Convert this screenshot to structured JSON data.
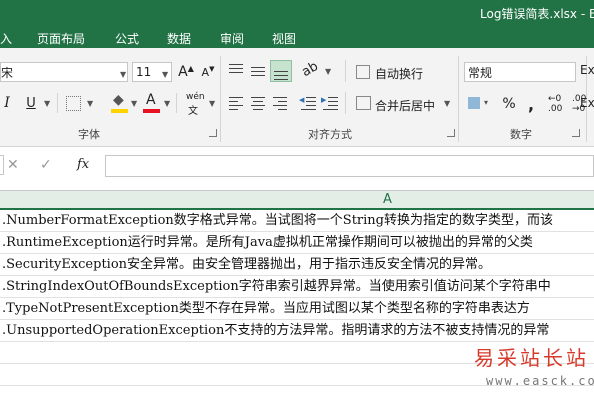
{
  "window": {
    "title": "Log错误简表.xlsx - Exc"
  },
  "tabs": [
    "入",
    "页面布局",
    "公式",
    "数据",
    "审阅",
    "视图"
  ],
  "font_group": {
    "font_name": "宋",
    "font_size": "11",
    "grow_label": "A",
    "shrink_label": "A",
    "italic": "I",
    "underline": "U",
    "fill_letter": "◆",
    "font_color_letter": "A",
    "phonetic": "wén",
    "label": "字体",
    "fill_color": "#ffd400",
    "font_color": "#e81123"
  },
  "align_group": {
    "wrap_text": "自动换行",
    "merge_center": "合并后居中",
    "label": "对齐方式"
  },
  "number_group": {
    "format": "常规",
    "currency": "▾",
    "percent": "%",
    "comma": ",",
    "label": "数字",
    "next_group_partial": "Exc",
    "next_group_partial2": "Exc"
  },
  "formula_bar": {
    "cancel": "✕",
    "enter": "✓",
    "fx": "fx",
    "content": ""
  },
  "grid": {
    "column_header": "A",
    "rows": [
      ".NumberFormatException数字格式异常。当试图将一个String转换为指定的数字类型，而该",
      ".RuntimeException运行时异常。是所有Java虚拟机正常操作期间可以被抛出的异常的父类",
      ".SecurityException安全异常。由安全管理器抛出，用于指示违反安全情况的异常。",
      ".StringIndexOutOfBoundsException字符串索引越界异常。当使用索引值访问某个字符串中",
      ".TypeNotPresentException类型不存在异常。当应用试图以某个类型名称的字符串表达方",
      ".UnsupportedOperationException不支持的方法异常。指明请求的方法不被支持情况的异常"
    ]
  },
  "watermark": {
    "line1": "易采站长站",
    "line2": "www.easck.com"
  },
  "colors": {
    "excel_green": "#217346",
    "ribbon_bg": "#f3f3f3",
    "selected_header": "#e3eee7"
  }
}
